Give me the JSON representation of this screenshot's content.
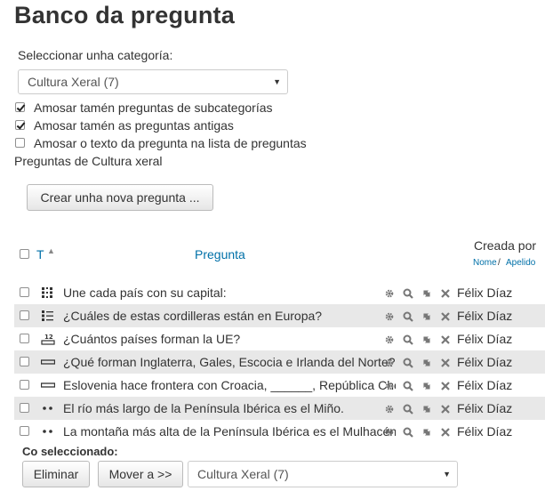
{
  "title": "Banco da pregunta",
  "category": {
    "label": "Seleccionar unha categoría:",
    "selected": "Cultura Xeral (7)"
  },
  "options": [
    {
      "label": "Amosar tamén preguntas de subcategorías",
      "checked": true
    },
    {
      "label": "Amosar tamén as preguntas antigas",
      "checked": true
    },
    {
      "label": "Amosar o texto da pregunta na lista de preguntas",
      "checked": false
    }
  ],
  "section_heading": "Preguntas de Cultura xeral",
  "create_button": "Crear unha nova pregunta ...",
  "table": {
    "col_type": "T",
    "col_question": "Pregunta",
    "col_created_by": "Creada por",
    "sort_first": "Nome",
    "sort_sep": " / ",
    "sort_last": "Apelido",
    "rows": [
      {
        "type_icon": "matching-icon",
        "text": "Une cada país con su capital:",
        "author": "Félix Díaz"
      },
      {
        "type_icon": "multichoice-icon",
        "text": "¿Cuáles de estas cordilleras están en Europa?",
        "author": "Félix Díaz"
      },
      {
        "type_icon": "numerical-icon",
        "text": "¿Cuántos países forman la UE?",
        "author": "Félix Díaz"
      },
      {
        "type_icon": "shortanswer-icon",
        "text": "¿Qué forman Inglaterra, Gales, Escocia e Irlanda del Norte?",
        "author": "Félix Díaz"
      },
      {
        "type_icon": "shortanswer-icon",
        "text": "Eslovenia hace frontera con Croacia, ______, República Checa",
        "author": "Félix Díaz"
      },
      {
        "type_icon": "truefalse-icon",
        "text": "El río más largo de la Península Ibérica es el Miño.",
        "author": "Félix Díaz"
      },
      {
        "type_icon": "truefalse-icon",
        "text": "La montaña más alta de la Península Ibérica es el Mulhacén.",
        "author": "Félix Díaz"
      }
    ]
  },
  "with_selected": {
    "label": "Co seleccionado:",
    "delete_button": "Eliminar",
    "move_button": "Mover a >>",
    "target_category": "Cultura Xeral (7)"
  }
}
